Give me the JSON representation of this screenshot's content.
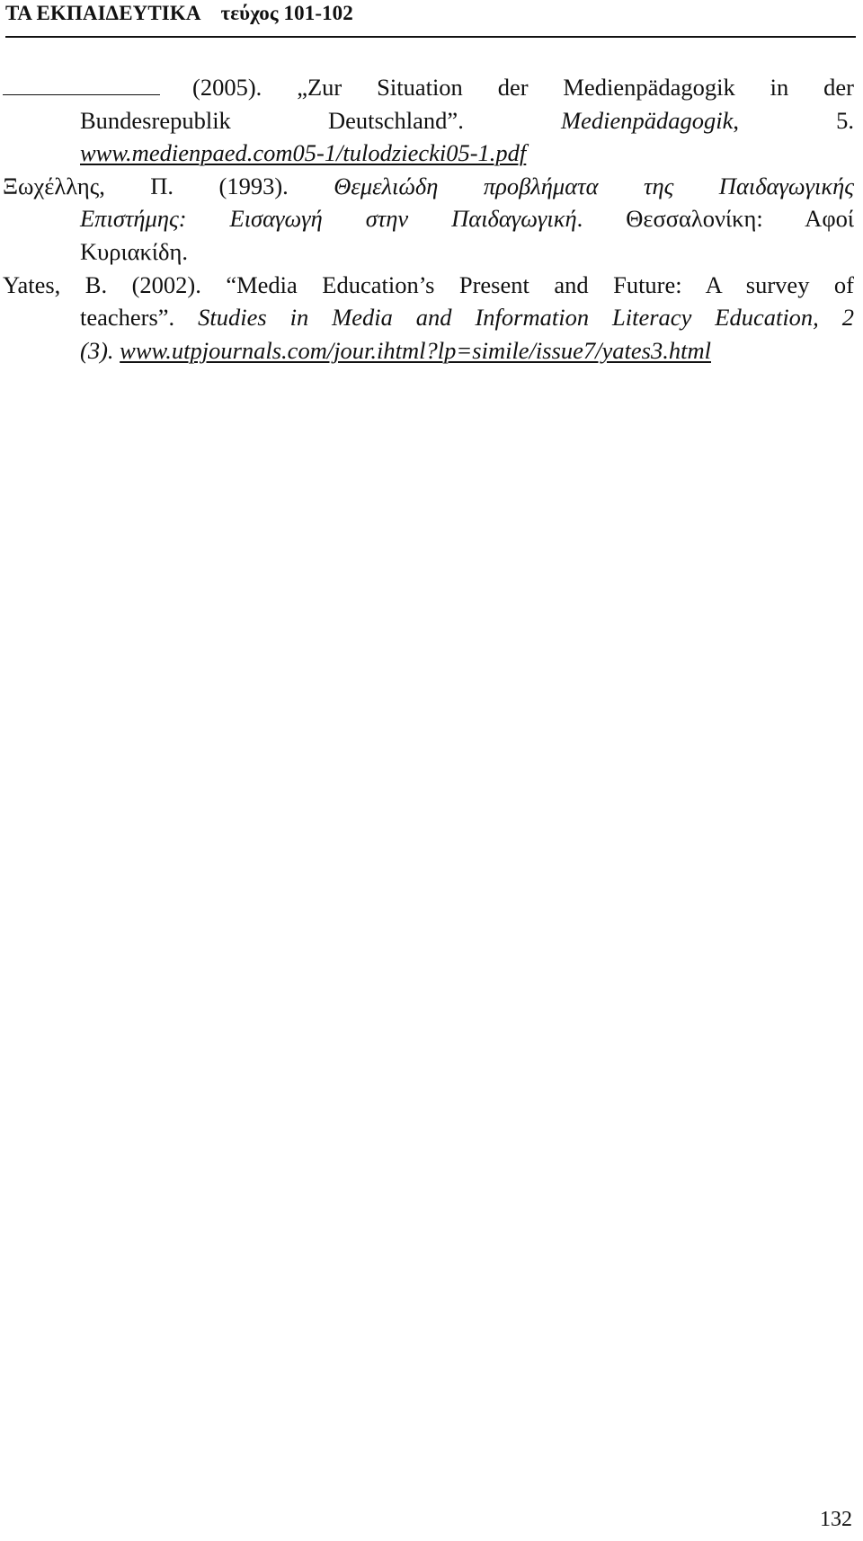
{
  "header": {
    "journal_title": "ΤΑ ΕΚΠΑΙΔΕΥΤΙΚΑ",
    "issue": "τεύχος 101-102"
  },
  "references": [
    {
      "author_placeholder": "",
      "year": "(2005).",
      "title_part1": "„Zur Situation der Medienpädagogik in der",
      "title_part2": "Bundesrepublik Deutschland”.",
      "journal": "Medienpädagogik",
      "volume": ", 5.",
      "url": "www.medienpaed.com05-1/tulodziecki05-1.pdf"
    },
    {
      "author": "Ξωχέλλης, Π. (1993).",
      "title_line1": "Θεμελιώδη προβλήματα της Παιδαγωγικής",
      "title_line2": "Επιστήμης: Εισαγωγή στην Παιδαγωγική",
      "publisher_line1": ". Θεσσαλονίκη: Αφοί",
      "publisher_line2": "Κυριακίδη."
    },
    {
      "author": "Yates, B. (2002).",
      "title_line1": "“Media Education’s Present and Future: A survey of",
      "title_line2": "teachers”.",
      "journal_line1": "Studies in Media and Information Literacy Education, 2",
      "journal_line2": "(3).",
      "url": "www.utpjournals.com/jour.ihtml?lp=simile/issue7/yates3.html"
    }
  ],
  "footer": {
    "page_number": "132"
  }
}
